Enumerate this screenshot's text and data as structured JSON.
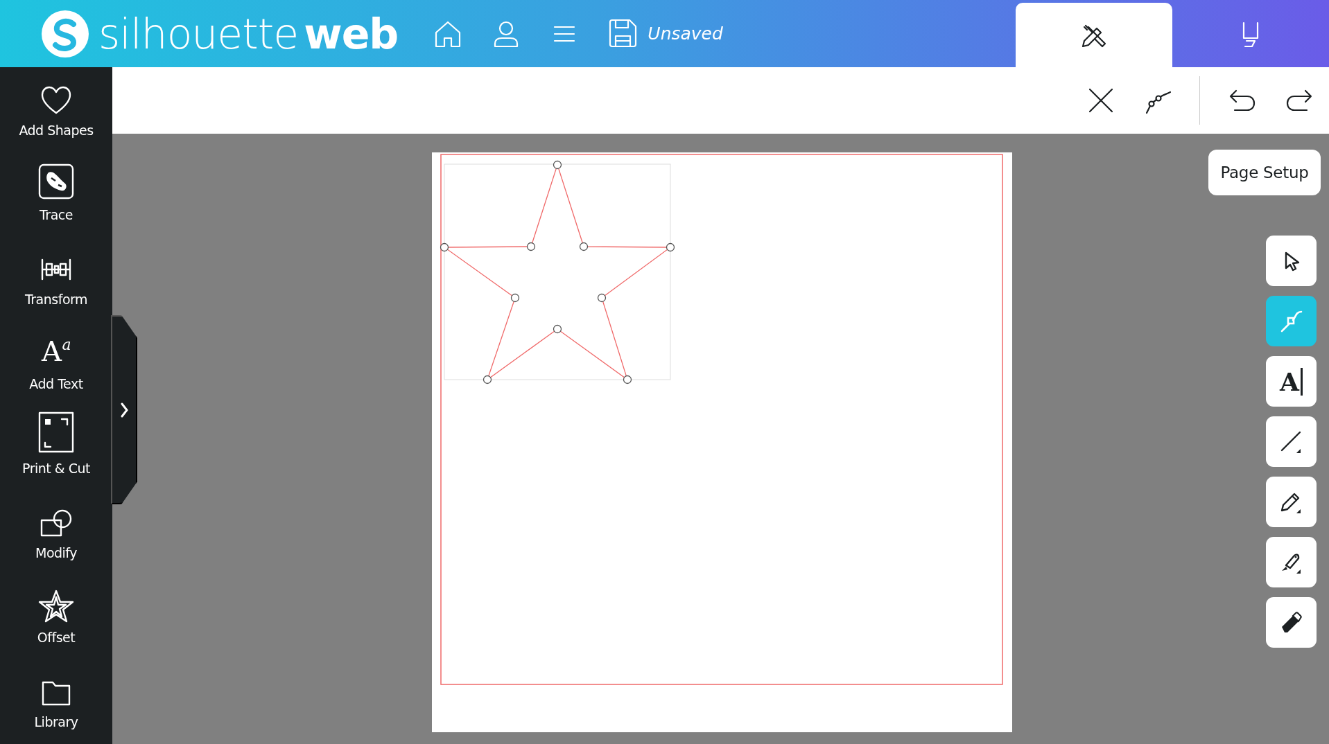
{
  "header": {
    "logo": {
      "light": "silhouette",
      "bold": "web"
    },
    "document_status": "Unsaved",
    "mode_tabs": [
      {
        "kind": "design",
        "selected": true
      },
      {
        "kind": "send",
        "selected": false
      }
    ]
  },
  "sidebar": {
    "items": [
      {
        "label": "Add Shapes",
        "kind": "heart"
      },
      {
        "label": "Trace",
        "kind": "trace"
      },
      {
        "label": "Transform",
        "kind": "transform"
      },
      {
        "label": "Add Text",
        "kind": "text",
        "glyphs": [
          "A",
          "a"
        ]
      },
      {
        "label": "Print & Cut",
        "kind": "printcut"
      },
      {
        "label": "Modify",
        "kind": "modify"
      },
      {
        "label": "Offset",
        "kind": "offset"
      },
      {
        "label": "Library",
        "kind": "library"
      }
    ]
  },
  "toolbar": {
    "actions": [
      {
        "kind": "close"
      },
      {
        "kind": "nodes"
      },
      {
        "kind": "undo"
      },
      {
        "kind": "redo"
      }
    ]
  },
  "canvas": {
    "shapes": [
      {
        "kind": "star"
      }
    ]
  },
  "page_setup": "Page Setup",
  "tools": [
    {
      "kind": "select",
      "selected": false
    },
    {
      "kind": "node",
      "selected": true
    },
    {
      "kind": "text",
      "glyph": "A",
      "selected": false
    },
    {
      "kind": "line",
      "selected": false
    },
    {
      "kind": "pencil",
      "selected": false
    },
    {
      "kind": "knife",
      "selected": false
    },
    {
      "kind": "eraser",
      "selected": false
    }
  ]
}
